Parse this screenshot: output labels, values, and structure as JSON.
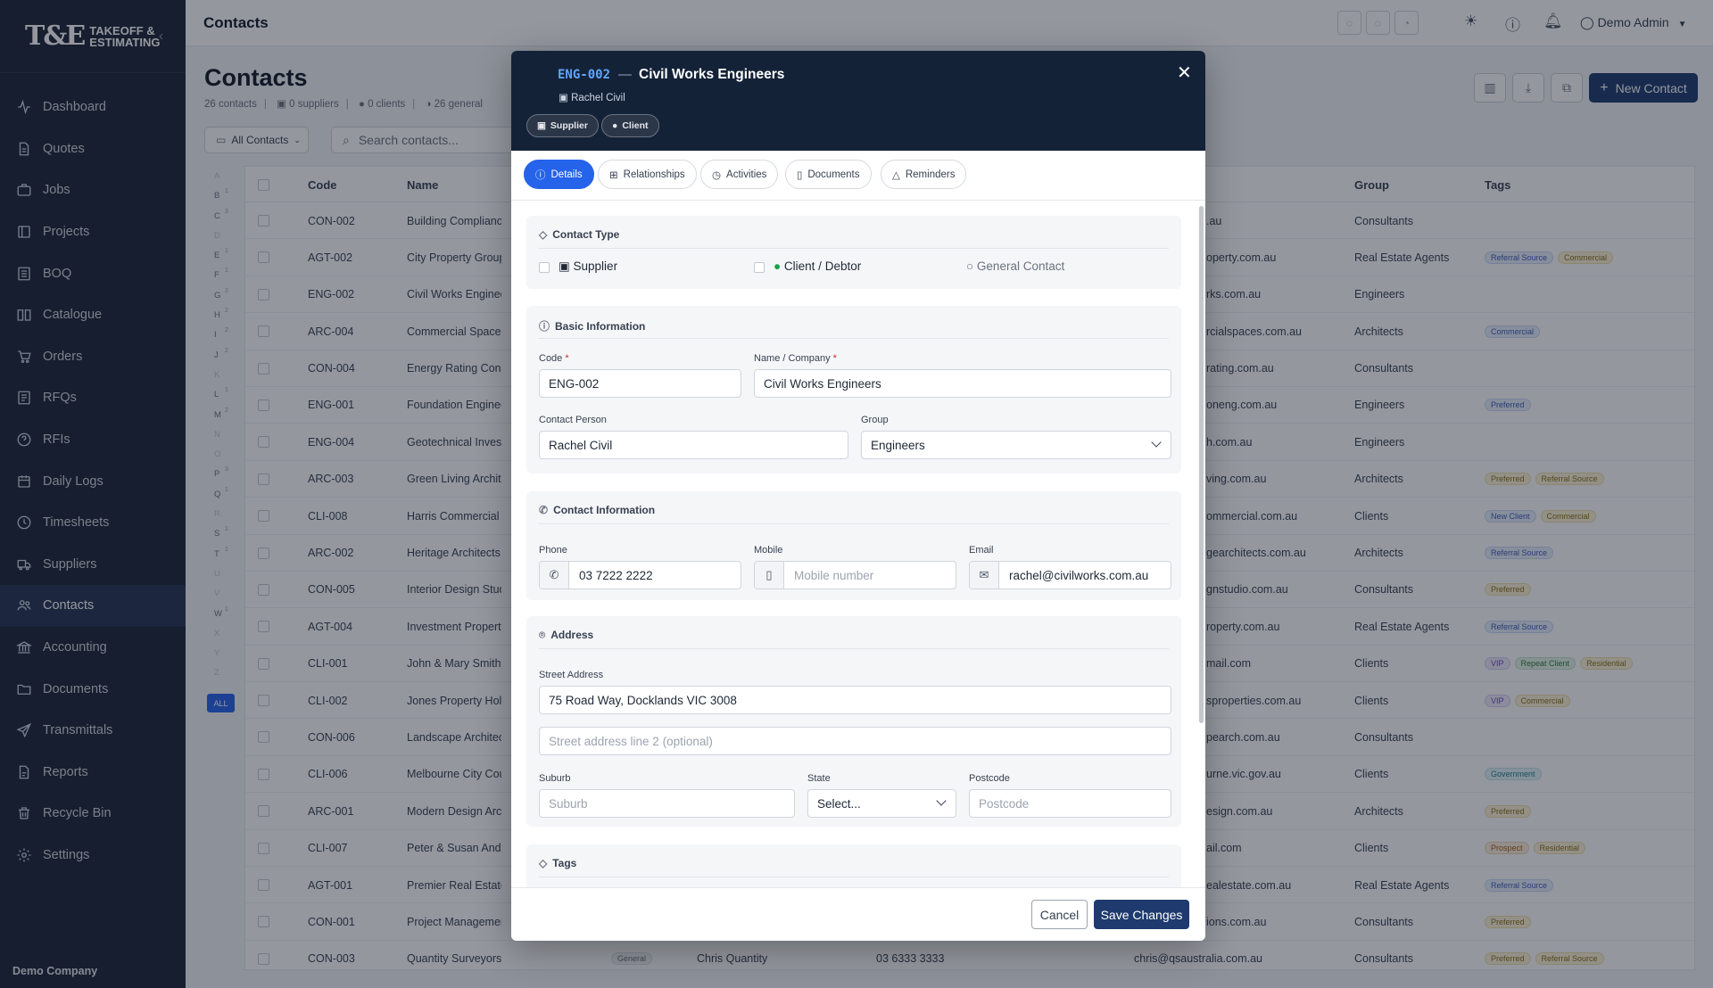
{
  "app": {
    "logo_mark": "T&E",
    "logo_line1": "TAKEOFF &",
    "logo_line2": "ESTIMATING",
    "company": "Demo Company"
  },
  "sidebar": {
    "items": [
      {
        "label": "Dashboard",
        "icon": "dashboard-icon"
      },
      {
        "label": "Quotes",
        "icon": "file-icon"
      },
      {
        "label": "Jobs",
        "icon": "briefcase-icon"
      },
      {
        "label": "Projects",
        "icon": "projects-icon"
      },
      {
        "label": "BOQ",
        "icon": "list-icon"
      },
      {
        "label": "Catalogue",
        "icon": "book-icon"
      },
      {
        "label": "Orders",
        "icon": "cart-icon"
      },
      {
        "label": "RFQs",
        "icon": "rfq-icon"
      },
      {
        "label": "RFIs",
        "icon": "help-icon"
      },
      {
        "label": "Daily Logs",
        "icon": "calendar-icon"
      },
      {
        "label": "Timesheets",
        "icon": "clock-icon"
      },
      {
        "label": "Suppliers",
        "icon": "truck-icon"
      },
      {
        "label": "Contacts",
        "icon": "users-icon",
        "active": true
      },
      {
        "label": "Accounting",
        "icon": "bank-icon"
      },
      {
        "label": "Documents",
        "icon": "folder-icon"
      },
      {
        "label": "Transmittals",
        "icon": "send-icon"
      },
      {
        "label": "Reports",
        "icon": "report-icon"
      },
      {
        "label": "Recycle Bin",
        "icon": "trash-icon"
      },
      {
        "label": "Settings",
        "icon": "gear-icon"
      }
    ]
  },
  "topbar": {
    "title": "Contacts",
    "user": "Demo Admin"
  },
  "page": {
    "title": "Contacts",
    "stats": {
      "contacts": "26 contacts",
      "suppliers": "0 suppliers",
      "clients": "0 clients",
      "general": "26 general"
    },
    "filter_label": "All Contacts",
    "search_placeholder": "Search contacts...",
    "new_button": "New Contact"
  },
  "alphabet": [
    {
      "l": "A",
      "c": "",
      "dim": true
    },
    {
      "l": "B",
      "c": "1"
    },
    {
      "l": "C",
      "c": "3"
    },
    {
      "l": "D",
      "c": "",
      "dim": true
    },
    {
      "l": "E",
      "c": "1"
    },
    {
      "l": "F",
      "c": "1"
    },
    {
      "l": "G",
      "c": "2"
    },
    {
      "l": "H",
      "c": "2"
    },
    {
      "l": "I",
      "c": "2"
    },
    {
      "l": "J",
      "c": "2"
    },
    {
      "l": "K",
      "c": "",
      "dim": true
    },
    {
      "l": "L",
      "c": "1"
    },
    {
      "l": "M",
      "c": "2"
    },
    {
      "l": "N",
      "c": "",
      "dim": true
    },
    {
      "l": "O",
      "c": "",
      "dim": true
    },
    {
      "l": "P",
      "c": "3"
    },
    {
      "l": "Q",
      "c": "1"
    },
    {
      "l": "R",
      "c": "",
      "dim": true
    },
    {
      "l": "S",
      "c": "1"
    },
    {
      "l": "T",
      "c": "1"
    },
    {
      "l": "U",
      "c": "",
      "dim": true
    },
    {
      "l": "V",
      "c": "",
      "dim": true
    },
    {
      "l": "W",
      "c": "1"
    },
    {
      "l": "X",
      "c": "",
      "dim": true
    },
    {
      "l": "Y",
      "c": "",
      "dim": true
    },
    {
      "l": "Z",
      "c": "",
      "dim": true
    }
  ],
  "alphabet_all": "ALL",
  "table": {
    "columns": {
      "code": "Code",
      "name": "Name",
      "group": "Group",
      "tags": "Tags"
    },
    "rows": [
      {
        "code": "CON-002",
        "name": "Building Compliance E",
        "email": ".au",
        "group": "Consultants",
        "tags": []
      },
      {
        "code": "AGT-002",
        "name": "City Property Group",
        "email": "operty.com.au",
        "group": "Real Estate Agents",
        "tags": [
          {
            "t": "Referral Source",
            "c": "blue"
          },
          {
            "t": "Commercial",
            "c": "yellow"
          }
        ]
      },
      {
        "code": "ENG-002",
        "name": "Civil Works Engineers",
        "email": "rks.com.au",
        "group": "Engineers",
        "tags": []
      },
      {
        "code": "ARC-004",
        "name": "Commercial Spaces De",
        "email": "rcialspaces.com.au",
        "group": "Architects",
        "tags": [
          {
            "t": "Commercial",
            "c": "blue"
          }
        ]
      },
      {
        "code": "CON-004",
        "name": "Energy Rating Consult",
        "email": "rating.com.au",
        "group": "Consultants",
        "tags": []
      },
      {
        "code": "ENG-001",
        "name": "Foundation Engineerin",
        "email": "oneng.com.au",
        "group": "Engineers",
        "tags": [
          {
            "t": "Preferred",
            "c": "blue"
          }
        ]
      },
      {
        "code": "ENG-004",
        "name": "Geotechnical Investiga",
        "email": "h.com.au",
        "group": "Engineers",
        "tags": []
      },
      {
        "code": "ARC-003",
        "name": "Green Living Architect",
        "email": "ving.com.au",
        "group": "Architects",
        "tags": [
          {
            "t": "Preferred",
            "c": "yellow"
          },
          {
            "t": "Referral Source",
            "c": "yellow"
          }
        ]
      },
      {
        "code": "CLI-008",
        "name": "Harris Commercial Gro",
        "email": "ommercial.com.au",
        "group": "Clients",
        "tags": [
          {
            "t": "New Client",
            "c": "blue"
          },
          {
            "t": "Commercial",
            "c": "yellow"
          }
        ]
      },
      {
        "code": "ARC-002",
        "name": "Heritage Architects Pty",
        "email": "gearchitects.com.au",
        "group": "Architects",
        "tags": [
          {
            "t": "Referral Source",
            "c": "blue"
          }
        ]
      },
      {
        "code": "CON-005",
        "name": "Interior Design Studio",
        "email": "gnstudio.com.au",
        "group": "Consultants",
        "tags": [
          {
            "t": "Preferred",
            "c": "yellow"
          }
        ]
      },
      {
        "code": "AGT-004",
        "name": "Investment Property S",
        "email": "roperty.com.au",
        "group": "Real Estate Agents",
        "tags": [
          {
            "t": "Referral Source",
            "c": "blue"
          }
        ]
      },
      {
        "code": "CLI-001",
        "name": "John & Mary Smith",
        "email": "mail.com",
        "group": "Clients",
        "tags": [
          {
            "t": "VIP",
            "c": "purple"
          },
          {
            "t": "Repeat Client",
            "c": "green"
          },
          {
            "t": "Residential",
            "c": "yellow"
          }
        ]
      },
      {
        "code": "CLI-002",
        "name": "Jones Property Holdin",
        "email": "sproperties.com.au",
        "group": "Clients",
        "tags": [
          {
            "t": "VIP",
            "c": "purple"
          },
          {
            "t": "Commercial",
            "c": "yellow"
          }
        ]
      },
      {
        "code": "CON-006",
        "name": "Landscape Architects \\",
        "email": "pearch.com.au",
        "group": "Consultants",
        "tags": []
      },
      {
        "code": "CLI-006",
        "name": "Melbourne City Counc",
        "email": "urne.vic.gov.au",
        "group": "Clients",
        "tags": [
          {
            "t": "Government",
            "c": "cyan"
          }
        ]
      },
      {
        "code": "ARC-001",
        "name": "Modern Design Archit",
        "email": "esign.com.au",
        "group": "Architects",
        "tags": [
          {
            "t": "Preferred",
            "c": "yellow"
          }
        ]
      },
      {
        "code": "CLI-007",
        "name": "Peter & Susan Anders",
        "email": "ail.com",
        "group": "Clients",
        "tags": [
          {
            "t": "Prospect",
            "c": "orange"
          },
          {
            "t": "Residential",
            "c": "yellow"
          }
        ]
      },
      {
        "code": "AGT-001",
        "name": "Premier Real Estate",
        "email": "ealestate.com.au",
        "group": "Real Estate Agents",
        "tags": [
          {
            "t": "Referral Source",
            "c": "blue"
          }
        ]
      },
      {
        "code": "CON-001",
        "name": "Project Management S",
        "email": "ions.com.au",
        "group": "Consultants",
        "tags": [
          {
            "t": "Preferred",
            "c": "yellow"
          }
        ]
      },
      {
        "code": "CON-003",
        "name": "Quantity Surveyors Australia",
        "type": "General",
        "person": "Chris Quantity",
        "phone": "03 6333 3333",
        "email": "chris@qsaustralia.com.au",
        "group": "Consultants",
        "tags": [
          {
            "t": "Preferred",
            "c": "yellow"
          },
          {
            "t": "Referral Source",
            "c": "yellow"
          }
        ]
      }
    ]
  },
  "modal": {
    "code": "ENG-002",
    "dash": "—",
    "name": "Civil Works Engineers",
    "person": "Rachel Civil",
    "badges": [
      "Supplier",
      "Client"
    ],
    "tabs": [
      "Details",
      "Relationships",
      "Activities",
      "Documents",
      "Reminders"
    ],
    "contact_type": {
      "title": "Contact Type",
      "supplier": "Supplier",
      "client": "Client / Debtor",
      "general": "General Contact"
    },
    "basic": {
      "title": "Basic Information",
      "code_label": "Code",
      "code_value": "ENG-002",
      "name_label": "Name / Company",
      "name_value": "Civil Works Engineers",
      "person_label": "Contact Person",
      "person_value": "Rachel Civil",
      "group_label": "Group",
      "group_value": "Engineers",
      "required_mark": "*"
    },
    "contact": {
      "title": "Contact Information",
      "phone_label": "Phone",
      "phone_value": "03 7222 2222",
      "mobile_label": "Mobile",
      "mobile_placeholder": "Mobile number",
      "email_label": "Email",
      "email_value": "rachel@civilworks.com.au"
    },
    "address": {
      "title": "Address",
      "street_label": "Street Address",
      "street_value": "75 Road Way, Docklands VIC 3008",
      "street2_placeholder": "Street address line 2 (optional)",
      "suburb_label": "Suburb",
      "suburb_placeholder": "Suburb",
      "state_label": "State",
      "state_value": "Select...",
      "postcode_label": "Postcode",
      "postcode_placeholder": "Postcode"
    },
    "tags": {
      "title": "Tags"
    },
    "cancel": "Cancel",
    "save": "Save Changes"
  }
}
